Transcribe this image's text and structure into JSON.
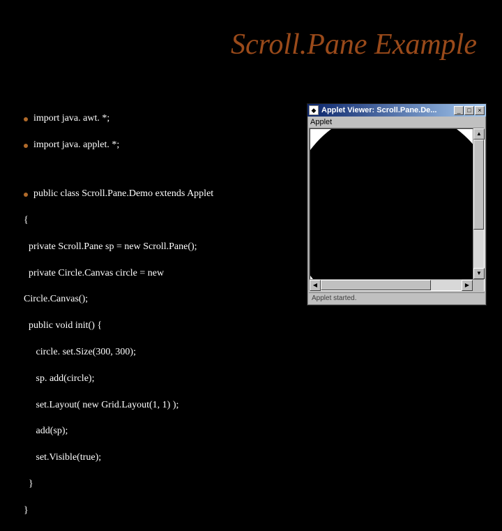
{
  "title": "Scroll.Pane Example",
  "code": {
    "line1": "import java. awt. *;",
    "line2": "import java. applet. *;",
    "line3": "public class Scroll.Pane.Demo extends Applet",
    "line4": "{",
    "line5": "  private Scroll.Pane sp = new Scroll.Pane();",
    "line6": "  private Circle.Canvas circle = new",
    "line7": "Circle.Canvas();",
    "line8": "  public void init() {",
    "line9": "     circle. set.Size(300, 300);",
    "line10": "     sp. add(circle);",
    "line11": "     set.Layout( new Grid.Layout(1, 1) );",
    "line12": "     add(sp);",
    "line13": "     set.Visible(true);",
    "line14": "  }",
    "line15": "}"
  },
  "applet": {
    "title": "Applet Viewer: Scroll.Pane.De...",
    "label": "Applet",
    "status": "Applet started.",
    "btn_min": "_",
    "btn_max": "□",
    "btn_close": "×",
    "arr_up": "▲",
    "arr_down": "▼",
    "arr_left": "◀",
    "arr_right": "▶",
    "icon_glyph": "◆"
  }
}
